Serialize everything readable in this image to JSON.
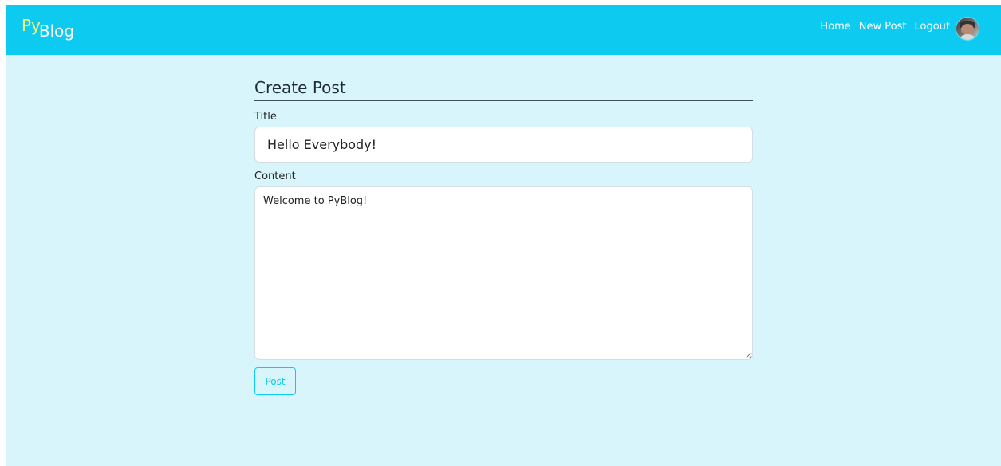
{
  "navbar": {
    "brand": {
      "py": "Py",
      "blog": "Blog"
    },
    "links": [
      "Home",
      "New Post",
      "Logout"
    ],
    "avatar_icon": "user-avatar-icon",
    "background_color": "#0dcaf0"
  },
  "main": {
    "background_color": "#d7f5fa",
    "form_title": "Create Post",
    "title_label": "Title",
    "title_value": "Hello Everybody!",
    "content_label": "Content",
    "content_value": "Welcome to PyBlog!",
    "post_button_label": "Post"
  },
  "colors": {
    "accent": "#0dcaf0",
    "brand_yellow": "#fff36b",
    "border": "#d6dde4"
  }
}
